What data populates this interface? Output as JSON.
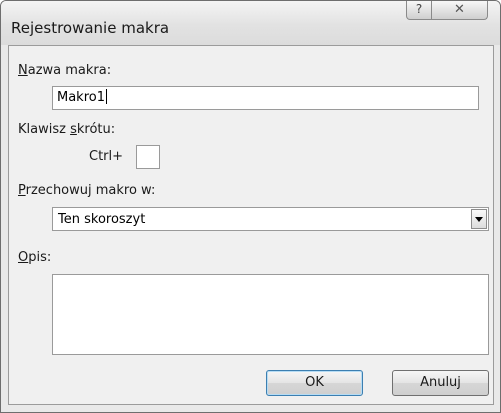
{
  "window": {
    "title": "Rejestrowanie makra",
    "help_glyph": "?",
    "close_glyph": "✕"
  },
  "macro_name": {
    "label_accel": "N",
    "label_rest": "azwa makra:",
    "value": "Makro1"
  },
  "shortcut": {
    "label_before": "Klawisz ",
    "label_accel": "s",
    "label_after": "krótu:",
    "prefix": "Ctrl+",
    "value": ""
  },
  "store_in": {
    "label_accel": "P",
    "label_rest": "rzechowuj makro w:",
    "selected": "Ten skoroszyt"
  },
  "description": {
    "label_accel": "O",
    "label_rest": "pis:",
    "value": ""
  },
  "buttons": {
    "ok": "OK",
    "cancel": "Anuluj"
  }
}
